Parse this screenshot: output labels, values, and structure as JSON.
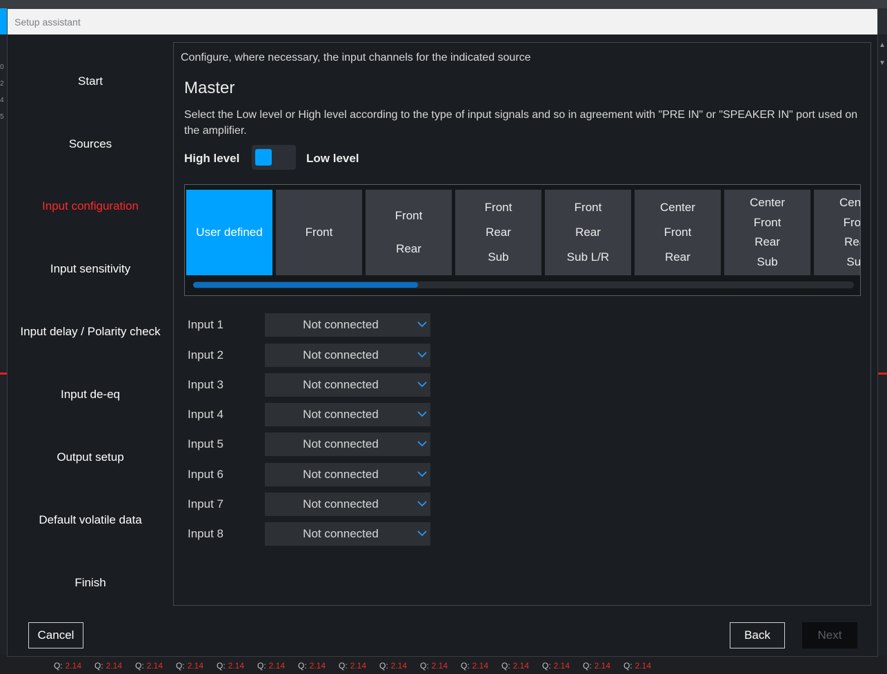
{
  "window": {
    "title": "Setup assistant"
  },
  "nav": {
    "items": [
      {
        "label": "Start",
        "active": false
      },
      {
        "label": "Sources",
        "active": false
      },
      {
        "label": "Input configuration",
        "active": true
      },
      {
        "label": "Input sensitivity",
        "active": false
      },
      {
        "label": "Input delay / Polarity check",
        "active": false
      },
      {
        "label": "Input de-eq",
        "active": false
      },
      {
        "label": "Output setup",
        "active": false
      },
      {
        "label": "Default volatile data",
        "active": false
      },
      {
        "label": "Finish",
        "active": false
      }
    ]
  },
  "main": {
    "intro": "Configure, where necessary, the input channels for the indicated source",
    "source_title": "Master",
    "description": "Select the Low level or High level according to the type of input signals and so in agreement with \"PRE IN\" or \"SPEAKER IN\" port used on the amplifier.",
    "level": {
      "high_label": "High level",
      "low_label": "Low level",
      "selected": "High level"
    },
    "presets": [
      {
        "lines": [
          "User defined"
        ],
        "selected": true
      },
      {
        "lines": [
          "Front"
        ],
        "selected": false
      },
      {
        "lines": [
          "Front",
          "Rear"
        ],
        "selected": false
      },
      {
        "lines": [
          "Front",
          "Rear",
          "Sub"
        ],
        "selected": false
      },
      {
        "lines": [
          "Front",
          "Rear",
          "Sub L/R"
        ],
        "selected": false
      },
      {
        "lines": [
          "Center",
          "Front",
          "Rear"
        ],
        "selected": false
      },
      {
        "lines": [
          "Center",
          "Front",
          "Rear",
          "Sub"
        ],
        "selected": false
      },
      {
        "lines": [
          "Center",
          "Front",
          "Rear",
          "Sub"
        ],
        "selected": false
      }
    ],
    "preset_scroll_fraction": 0.34,
    "inputs": [
      {
        "label": "Input 1",
        "value": "Not connected"
      },
      {
        "label": "Input 2",
        "value": "Not connected"
      },
      {
        "label": "Input 3",
        "value": "Not connected"
      },
      {
        "label": "Input 4",
        "value": "Not connected"
      },
      {
        "label": "Input 5",
        "value": "Not connected"
      },
      {
        "label": "Input 6",
        "value": "Not connected"
      },
      {
        "label": "Input 7",
        "value": "Not connected"
      },
      {
        "label": "Input 8",
        "value": "Not connected"
      }
    ]
  },
  "footer": {
    "cancel_label": "Cancel",
    "back_label": "Back",
    "next_label": "Next"
  },
  "background": {
    "left_digits": [
      "0",
      "2",
      "4",
      "5"
    ],
    "q_items": [
      "Q:",
      "2.14"
    ]
  },
  "colors": {
    "accent": "#00a2ff",
    "active_nav": "#ff2a2a",
    "dialog_bg": "#1a1d21"
  }
}
